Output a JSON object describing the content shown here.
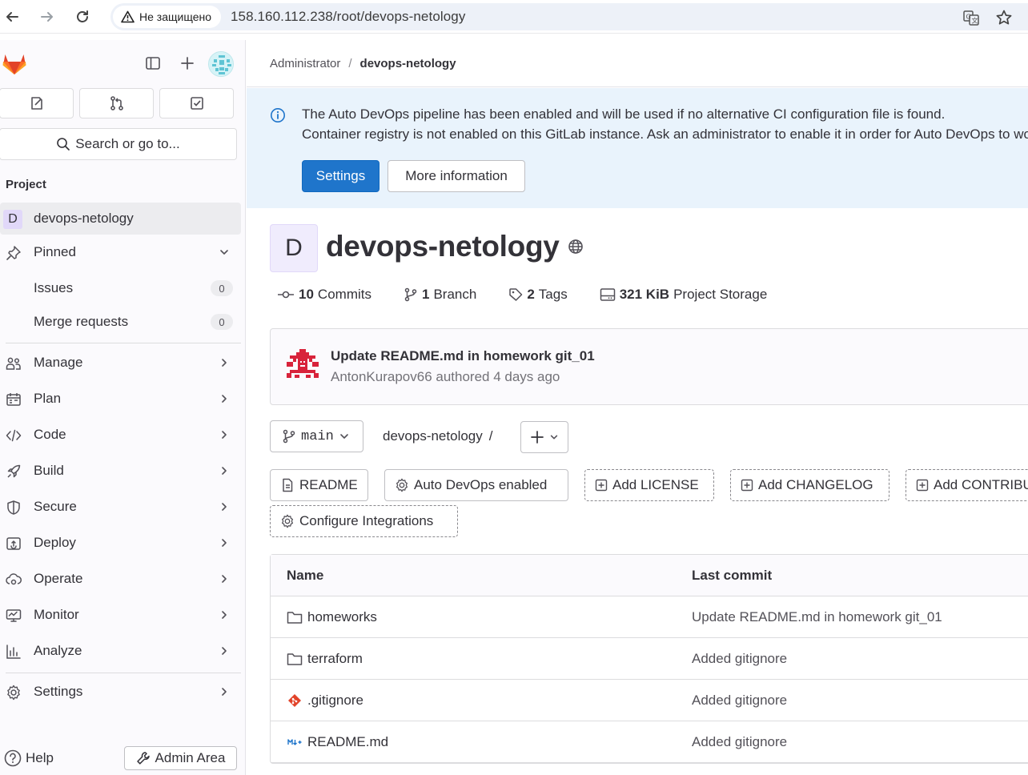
{
  "browser": {
    "security_label": "Не защищено",
    "url": "158.160.112.238/root/devops-netology"
  },
  "sidebar": {
    "search_placeholder": "Search or go to...",
    "section_title": "Project",
    "project_letter": "D",
    "project_name": "devops-netology",
    "pinned_label": "Pinned",
    "pinned_items": [
      {
        "label": "Issues",
        "count": "0"
      },
      {
        "label": "Merge requests",
        "count": "0"
      }
    ],
    "nav_items": [
      {
        "label": "Manage",
        "icon": "users-icon"
      },
      {
        "label": "Plan",
        "icon": "calendar-icon"
      },
      {
        "label": "Code",
        "icon": "code-icon"
      },
      {
        "label": "Build",
        "icon": "rocket-icon"
      },
      {
        "label": "Secure",
        "icon": "shield-icon"
      },
      {
        "label": "Deploy",
        "icon": "deploy-icon"
      },
      {
        "label": "Operate",
        "icon": "cloud-gear-icon"
      },
      {
        "label": "Monitor",
        "icon": "monitor-icon"
      },
      {
        "label": "Analyze",
        "icon": "chart-icon"
      },
      {
        "label": "Settings",
        "icon": "gear-icon"
      }
    ],
    "help_label": "Help",
    "admin_label": "Admin Area"
  },
  "breadcrumb": {
    "parent": "Administrator",
    "current": "devops-netology"
  },
  "alert": {
    "line1": "The Auto DevOps pipeline has been enabled and will be used if no alternative CI configuration file is found.",
    "line2": "Container registry is not enabled on this GitLab instance. Ask an administrator to enable it in order for Auto DevOps to work.",
    "primary_button": "Settings",
    "secondary_button": "More information"
  },
  "project": {
    "avatar_letter": "D",
    "title": "devops-netology",
    "stats": {
      "commits_count": "10",
      "commits_label": "Commits",
      "branch_count": "1",
      "branch_label": "Branch",
      "tags_count": "2",
      "tags_label": "Tags",
      "storage_size": "321 KiB",
      "storage_label": "Project Storage"
    }
  },
  "last_commit": {
    "title": "Update README.md in homework git_01",
    "meta": "AntonKurapov66 authored 4 days ago"
  },
  "repo": {
    "branch": "main",
    "path": "devops-netology",
    "path_sep": "/"
  },
  "shortcuts": [
    {
      "label": "README",
      "style": "solid",
      "icon": "file-icon"
    },
    {
      "label": "Auto DevOps enabled",
      "style": "solid",
      "icon": "gear-icon"
    },
    {
      "label": "Add LICENSE",
      "style": "dashed",
      "icon": "plus-square-icon"
    },
    {
      "label": "Add CHANGELOG",
      "style": "dashed",
      "icon": "plus-square-icon"
    },
    {
      "label": "Add CONTRIBUTING",
      "style": "dashed",
      "icon": "plus-square-icon"
    },
    {
      "label": "Configure Integrations",
      "style": "dashed",
      "icon": "gear-icon"
    }
  ],
  "files": {
    "columns": [
      "Name",
      "Last commit"
    ],
    "rows": [
      {
        "name": "homeworks",
        "type": "folder",
        "commit": "Update README.md in homework git_01"
      },
      {
        "name": "terraform",
        "type": "folder",
        "commit": "Added gitignore"
      },
      {
        "name": ".gitignore",
        "type": "git",
        "commit": "Added gitignore"
      },
      {
        "name": "README.md",
        "type": "markdown",
        "commit": "Added gitignore"
      }
    ]
  },
  "colors": {
    "primary": "#1f75cb",
    "alert_bg": "#e9f3fc",
    "sidebar_bg": "#fbfafd",
    "gitlab_orange": "#fc6d26"
  }
}
